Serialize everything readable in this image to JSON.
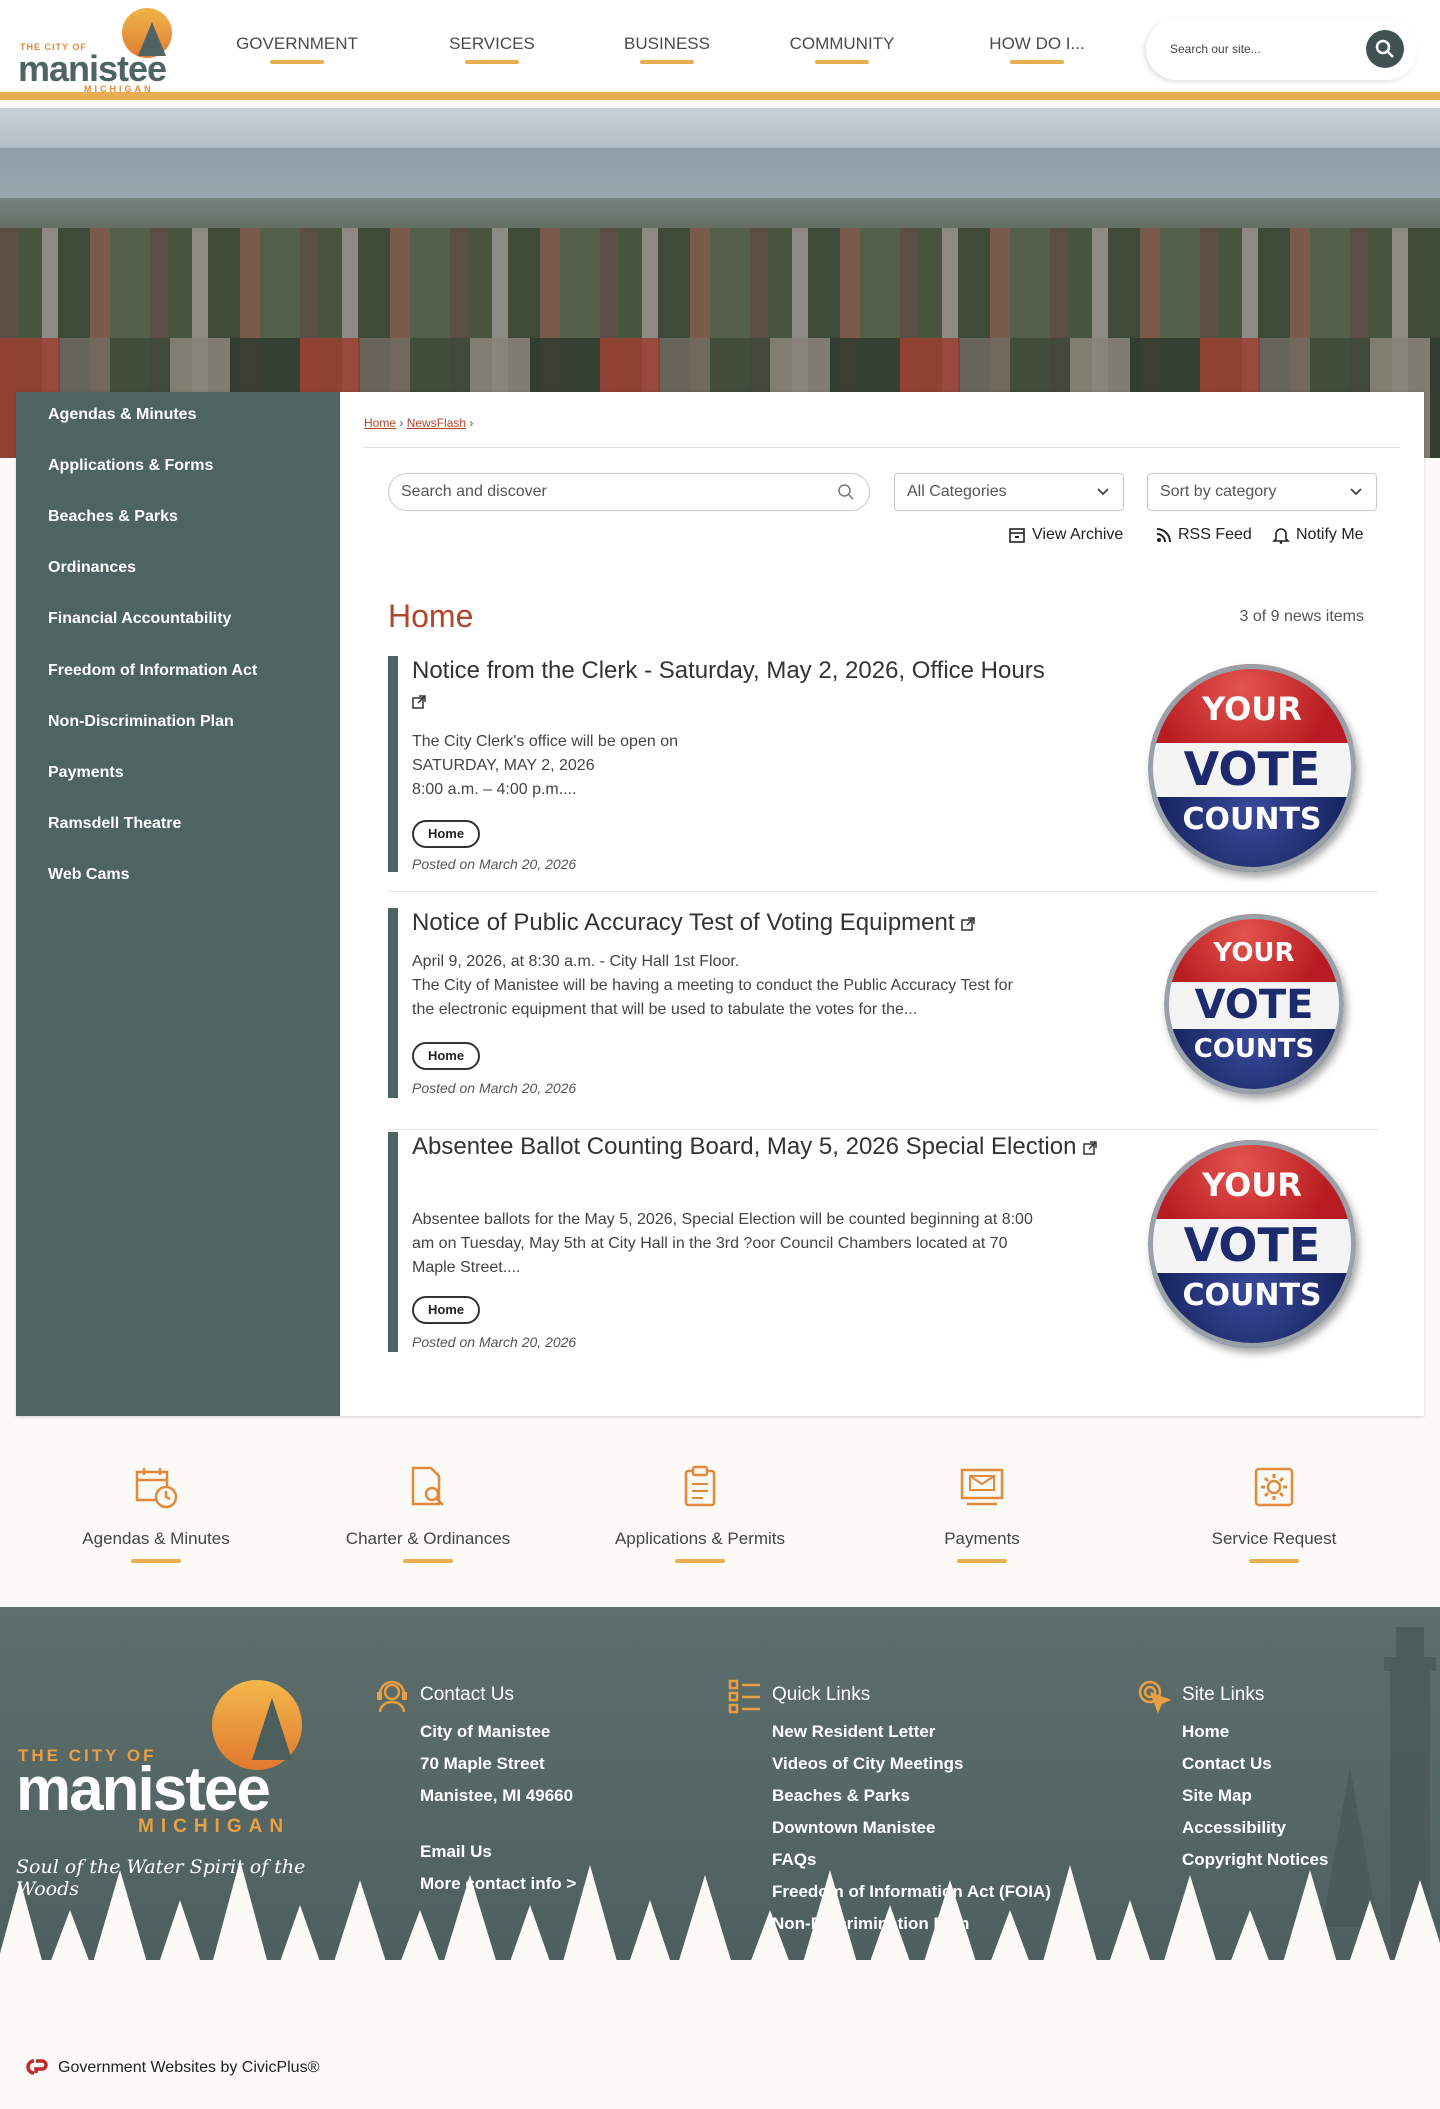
{
  "header": {
    "logo": {
      "small": "THE CITY OF",
      "big": "manistee",
      "state": "MICHIGAN"
    },
    "nav": [
      "GOVERNMENT",
      "SERVICES",
      "BUSINESS",
      "COMMUNITY",
      "HOW DO I..."
    ],
    "search_placeholder": "Search our site..."
  },
  "sidebar": {
    "items": [
      "Agendas & Minutes",
      "Applications & Forms",
      "Beaches & Parks",
      "Ordinances",
      "Financial Accountability",
      "Freedom of Information Act",
      "Non-Discrimination Plan",
      "Payments",
      "Ramsdell Theatre",
      "Web Cams"
    ]
  },
  "breadcrumb": {
    "home": "Home",
    "newsflash": "NewsFlash",
    "sep": "›"
  },
  "filters": {
    "search_placeholder": "Search and discover",
    "category": "All Categories",
    "sort": "Sort by category"
  },
  "tools": {
    "archive": "View Archive",
    "rss": "RSS Feed",
    "notify": "Notify Me"
  },
  "section": {
    "title": "Home",
    "count": "3 of 9 news items"
  },
  "news": [
    {
      "title": "Notice from the Clerk - Saturday, May 2, 2026, Office Hours",
      "desc": [
        "The City Clerk's office will be open on",
        "SATURDAY, MAY 2, 2026",
        "8:00 a.m. – 4:00 p.m...."
      ],
      "tag": "Home",
      "posted": "Posted on March 20, 2026"
    },
    {
      "title": "Notice of Public Accuracy Test of Voting Equipment",
      "desc": [
        "April 9, 2026, at 8:30 a.m. - City Hall 1st Floor.",
        "The City of Manistee will be having a meeting to conduct the Public Accuracy Test for",
        "the electronic equipment that will be used to tabulate the votes for the..."
      ],
      "tag": "Home",
      "posted": "Posted on March 20, 2026"
    },
    {
      "title": "Absentee Ballot Counting Board, May 5, 2026 Special Election",
      "desc": [
        "Absentee ballots for the May 5, 2026, Special Election will be counted beginning at 8:00",
        "am on Tuesday, May 5th at City Hall in the 3rd ?oor Council Chambers located at 70",
        "Maple Street...."
      ],
      "tag": "Home",
      "posted": "Posted on March 20, 2026"
    }
  ],
  "badge": {
    "your": "YOUR",
    "vote": "VOTE",
    "counts": "COUNTS"
  },
  "quick_links": [
    "Agendas & Minutes",
    "Charter & Ordinances",
    "Applications & Permits",
    "Payments",
    "Service Request"
  ],
  "footer": {
    "logo": {
      "small": "THE CITY OF",
      "big": "manistee",
      "state": "MICHIGAN",
      "tagline": "Soul of the Water Spirit of the Woods"
    },
    "contact": {
      "heading": "Contact Us",
      "lines": [
        "City of Manistee",
        "70 Maple Street",
        "Manistee, MI 49660"
      ],
      "email": "Email Us",
      "more": "More contact info >"
    },
    "quick": {
      "heading": "Quick Links",
      "items": [
        "New Resident Letter",
        "Videos of City Meetings",
        "Beaches & Parks",
        "Downtown Manistee",
        "FAQs",
        "Freedom of Information Act (FOIA)",
        "Non-Discrimination Plan"
      ]
    },
    "site": {
      "heading": "Site Links",
      "items": [
        "Home",
        "Contact Us",
        "Site Map",
        "Accessibility",
        "Copyright Notices"
      ]
    },
    "credit": "Government Websites by CivicPlus®"
  },
  "colors": {
    "accent": "#e9ad52",
    "sidebar": "#4d6462",
    "title": "#b2442a",
    "footer": "#56676a"
  }
}
